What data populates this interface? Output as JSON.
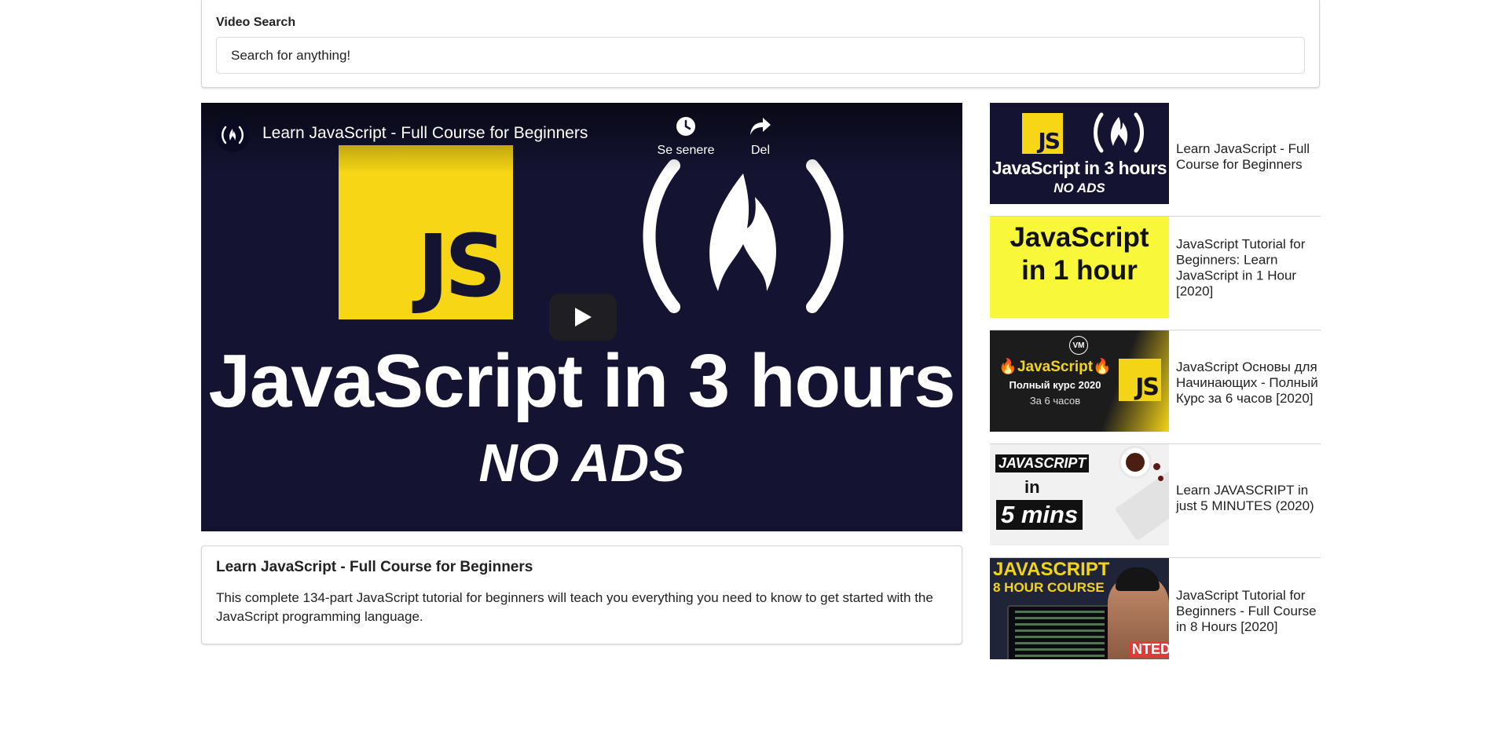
{
  "search": {
    "label": "Video Search",
    "value": "Search for anything!"
  },
  "player": {
    "title": "Learn JavaScript - Full Course for Beginners",
    "watch_later_label": "Se senere",
    "share_label": "Del",
    "thumb_js": "JS",
    "thumb_line1": "JavaScript in 3 hours",
    "thumb_line2": "NO ADS"
  },
  "detail": {
    "title": "Learn JavaScript - Full Course for Beginners",
    "description": "This complete 134-part JavaScript tutorial for beginners will teach you everything you need to know to get started with the JavaScript programming language."
  },
  "videos": [
    {
      "title": "Learn JavaScript - Full Course for Beginners",
      "thumb": {
        "js": "JS",
        "line1": "JavaScript in 3 hours",
        "line2": "NO ADS"
      }
    },
    {
      "title": "JavaScript Tutorial for Beginners: Learn JavaScript in 1 Hour [2020]",
      "thumb": {
        "line1": "JavaScript",
        "line2": "in 1 hour"
      }
    },
    {
      "title": "JavaScript Основы для Начинающих - Полный Курс за 6 часов [2020]",
      "thumb": {
        "vm": "VM",
        "line1": "🔥JavaScript🔥",
        "line2": "Полный курс 2020",
        "line3": "За 6 часов",
        "js": "JS"
      }
    },
    {
      "title": "Learn JAVASCRIPT in just 5 MINUTES (2020)",
      "thumb": {
        "line1": "JAVASCRIPT",
        "line2": "in",
        "line3": "5 mins"
      }
    },
    {
      "title": "JavaScript Tutorial for Beginners - Full Course in 8 Hours [2020]",
      "thumb": {
        "line1": "JAVASCRIPT",
        "line2": "8 HOUR COURSE",
        "badge": "NTED"
      }
    }
  ],
  "colors": {
    "js_yellow": "#f7d715",
    "navy": "#141432",
    "border": "#d4d4d5"
  }
}
